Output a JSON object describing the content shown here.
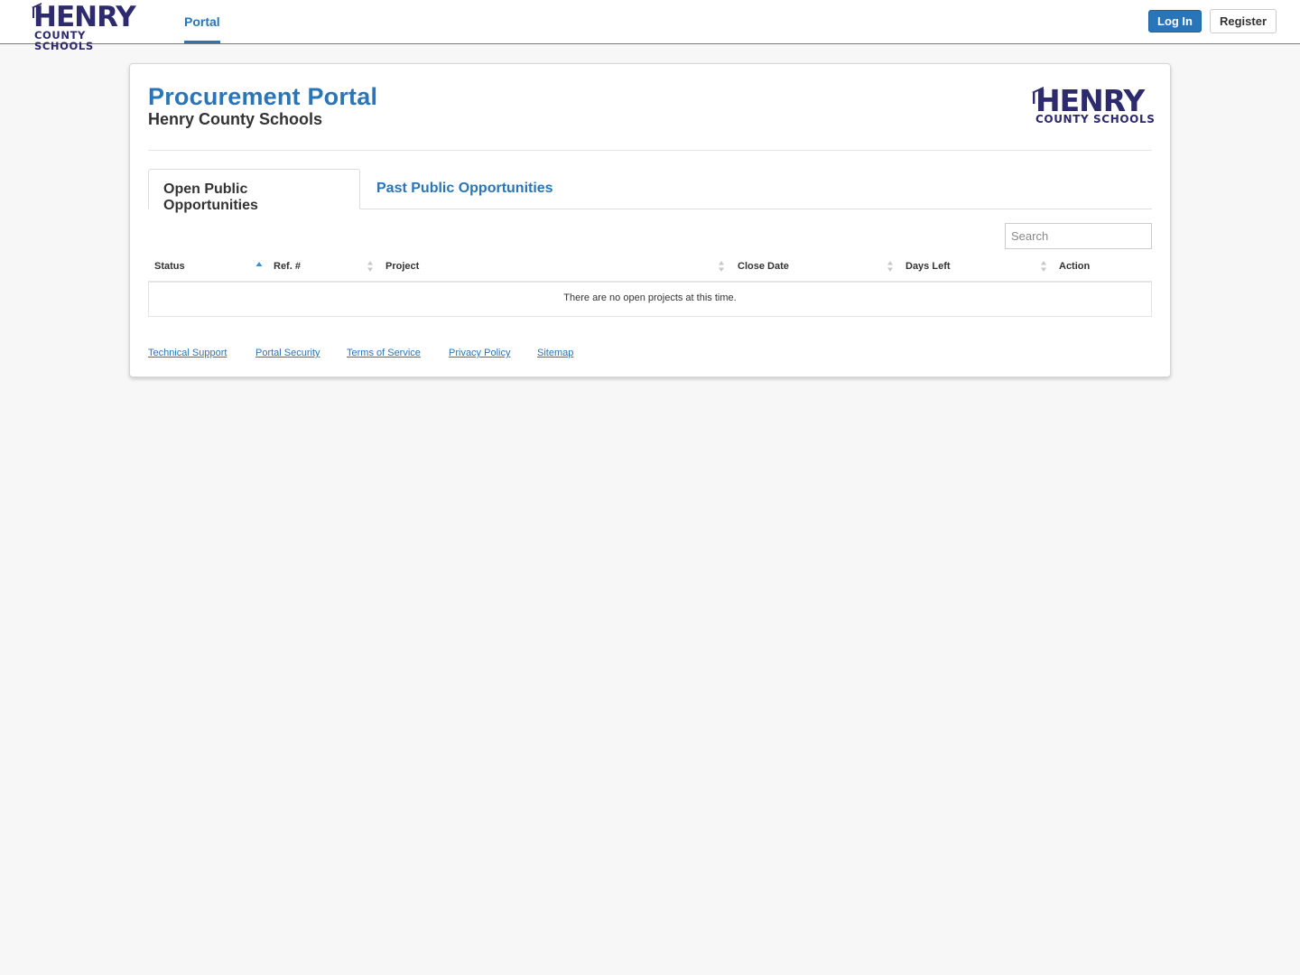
{
  "nav": {
    "logo": {
      "line1": "HENRY",
      "line2": "COUNTY SCHOOLS"
    },
    "portal_label": "Portal",
    "login_label": "Log In",
    "register_label": "Register"
  },
  "header": {
    "title": "Procurement Portal",
    "subtitle": "Henry County Schools",
    "logo": {
      "line1": "HENRY",
      "line2": "COUNTY SCHOOLS"
    }
  },
  "tabs": [
    {
      "label": "Open Public Opportunities",
      "active": true
    },
    {
      "label": "Past Public Opportunities",
      "active": false
    }
  ],
  "search": {
    "placeholder": "Search",
    "value": ""
  },
  "table": {
    "columns": [
      "Status",
      "Ref. #",
      "Project",
      "Close Date",
      "Days Left",
      "Action"
    ],
    "sorted_column": "Status",
    "sort_direction": "ascending",
    "rows": [],
    "empty_message": "There are no open projects at this time."
  },
  "footer": {
    "links": [
      "Technical Support",
      "Portal Security",
      "Terms of Service",
      "Privacy Policy",
      "Sitemap"
    ]
  },
  "colors": {
    "accent": "#2a74b8",
    "logo": "#2d2a6e",
    "background": "#f7f7f7"
  }
}
